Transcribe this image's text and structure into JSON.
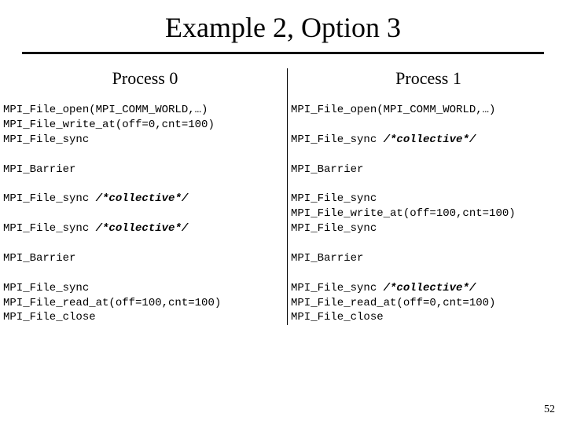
{
  "title": "Example 2, Option 3",
  "page_number": "52",
  "columns": [
    {
      "header": "Process 0",
      "lines": [
        {
          "t": "MPI_File_open(MPI_COMM_WORLD,…)"
        },
        {
          "t": "MPI_File_write_at(off=0,cnt=100)"
        },
        {
          "t": "MPI_File_sync"
        },
        {
          "t": ""
        },
        {
          "t": "MPI_Barrier"
        },
        {
          "t": ""
        },
        {
          "t": "MPI_File_sync ",
          "tail": "/*collective*/"
        },
        {
          "t": ""
        },
        {
          "t": "MPI_File_sync ",
          "tail": "/*collective*/"
        },
        {
          "t": ""
        },
        {
          "t": "MPI_Barrier"
        },
        {
          "t": ""
        },
        {
          "t": "MPI_File_sync"
        },
        {
          "t": "MPI_File_read_at(off=100,cnt=100)"
        },
        {
          "t": "MPI_File_close"
        }
      ]
    },
    {
      "header": "Process 1",
      "lines": [
        {
          "t": "MPI_File_open(MPI_COMM_WORLD,…)"
        },
        {
          "t": ""
        },
        {
          "t": "MPI_File_sync ",
          "tail": "/*collective*/"
        },
        {
          "t": ""
        },
        {
          "t": "MPI_Barrier"
        },
        {
          "t": ""
        },
        {
          "t": "MPI_File_sync"
        },
        {
          "t": "MPI_File_write_at(off=100,cnt=100)"
        },
        {
          "t": "MPI_File_sync"
        },
        {
          "t": ""
        },
        {
          "t": "MPI_Barrier"
        },
        {
          "t": ""
        },
        {
          "t": "MPI_File_sync ",
          "tail": "/*collective*/"
        },
        {
          "t": "MPI_File_read_at(off=0,cnt=100)"
        },
        {
          "t": "MPI_File_close"
        }
      ]
    }
  ]
}
